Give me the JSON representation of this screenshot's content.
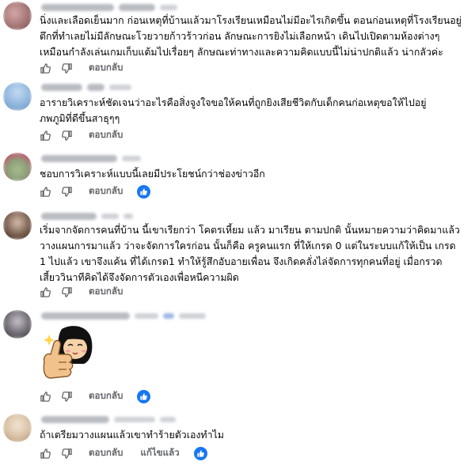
{
  "comments": [
    {
      "avatar_color": "#b98d8d",
      "lines": [
        "นิ่งและเลือดเย็นมาก ก่อนเหตุที่บ้านแล้วมาโรงเรียนเหมือนไม่มีอะไรเกิดขึ้น ตอนก่อนเหตุที่โรงเรียนอยู่",
        "ตึกที่ทำเลยไม่มีลักษณะโวยวายก้าวร้าวก่อน ลักษณะการยิงไม่เลือกหน้า เดินไปเปิดตามห้องต่างๆ",
        "เหมือนกำลังเล่นเกมเก็บแต้มไปเรื่อยๆ ลักษณะท่าทางและความคิดแบบนี้ไม่น่าปกติแล้ว น่ากลัวค่ะ"
      ],
      "reply_label": "ตอบกลับ",
      "liked": false
    },
    {
      "avatar_color": "#8fb6de",
      "lines": [
        "อารายวิเคราะห์ชัดเจนว่าอะไรคือสิ่งจูงใจขอให้คนที่ถูกยิงเสียชีวิตกับเด็กคนก่อเหตุขอให้ไปอยู่",
        "ภพภูมิที่ดีขึ้นสาธุๆๆ"
      ],
      "reply_label": "ตอบกลับ",
      "liked": false
    },
    {
      "avatar_color": "#8aa27a",
      "lines": [
        "ชอบการวิเคราะห์แบบนี้เลยมีประโยชน์กว่าช่องข่าวอีก"
      ],
      "reply_label": "ตอบกลับ",
      "liked": true
    },
    {
      "avatar_color": "#7a5f4e",
      "lines": [
        "เริ่มจากจัดการคนที่บ้าน นี้เขาเรียกว่า โคตรเหี้ยม แล้ว มาเรียน ตามปกติ นั้นหมายความว่าคิดมาแล้ว",
        "วางแผนการมาแล้ว ว่าจะจัดการใครก่อน นั้นก็คือ ครูคนแรก ที่ให้เกรด 0 แต่ในระบบแก้ให้เป็น เกรด",
        "1 ไปแล้ว เขาจึงแค้น ที่ได้เกรด1 ทำให้รู้สึกอับอายเพื่อน จึงเกิดคลั่งไล่จัดการทุกคนที่อยู่ เมื่อกรวด",
        "เสี้ยววินาทีคิดได้จึงจัดการตัวเองเพื่อหนีความผิด"
      ],
      "reply_label": "ตอบกลับ",
      "liked": false
    },
    {
      "avatar_color": "#6f6a72",
      "lines": [],
      "reply_label": "ตอบกลับ",
      "liked": true,
      "sticker": "thumbs-up-girl-sticker"
    },
    {
      "avatar_color": "#d9c2a6",
      "lines": [
        "ถ้าเตรียมวางแผนแล้วเขาทำร้ายตัวเองทำไม"
      ],
      "reply_label": "ตอบกลับ",
      "edit_label": "แก้ไขแล้ว",
      "liked": true
    }
  ]
}
